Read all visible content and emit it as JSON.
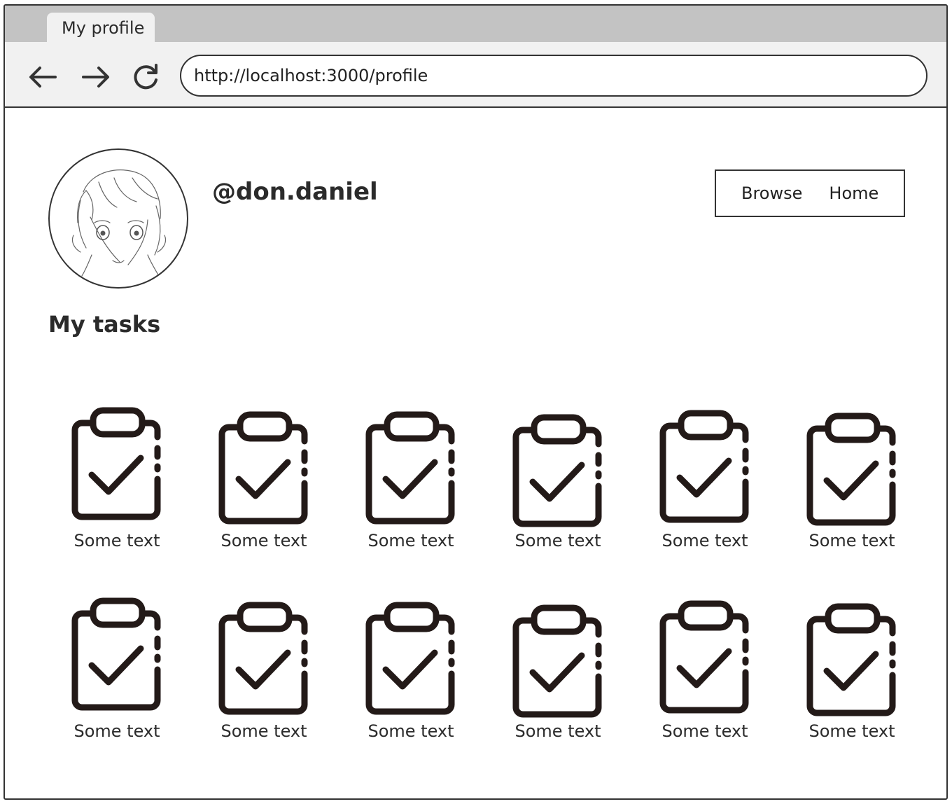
{
  "browser": {
    "tab_title": "My profile",
    "url": "http://localhost:3000/profile"
  },
  "profile": {
    "username": "@don.daniel"
  },
  "nav": {
    "browse": "Browse",
    "home": "Home"
  },
  "tasks": {
    "title": "My tasks",
    "icon": "clipboard-check-icon",
    "items": [
      {
        "label": "Some text"
      },
      {
        "label": "Some text"
      },
      {
        "label": "Some text"
      },
      {
        "label": "Some text"
      },
      {
        "label": "Some text"
      },
      {
        "label": "Some text"
      },
      {
        "label": "Some text"
      },
      {
        "label": "Some text"
      },
      {
        "label": "Some text"
      },
      {
        "label": "Some text"
      },
      {
        "label": "Some text"
      },
      {
        "label": "Some text"
      }
    ]
  }
}
